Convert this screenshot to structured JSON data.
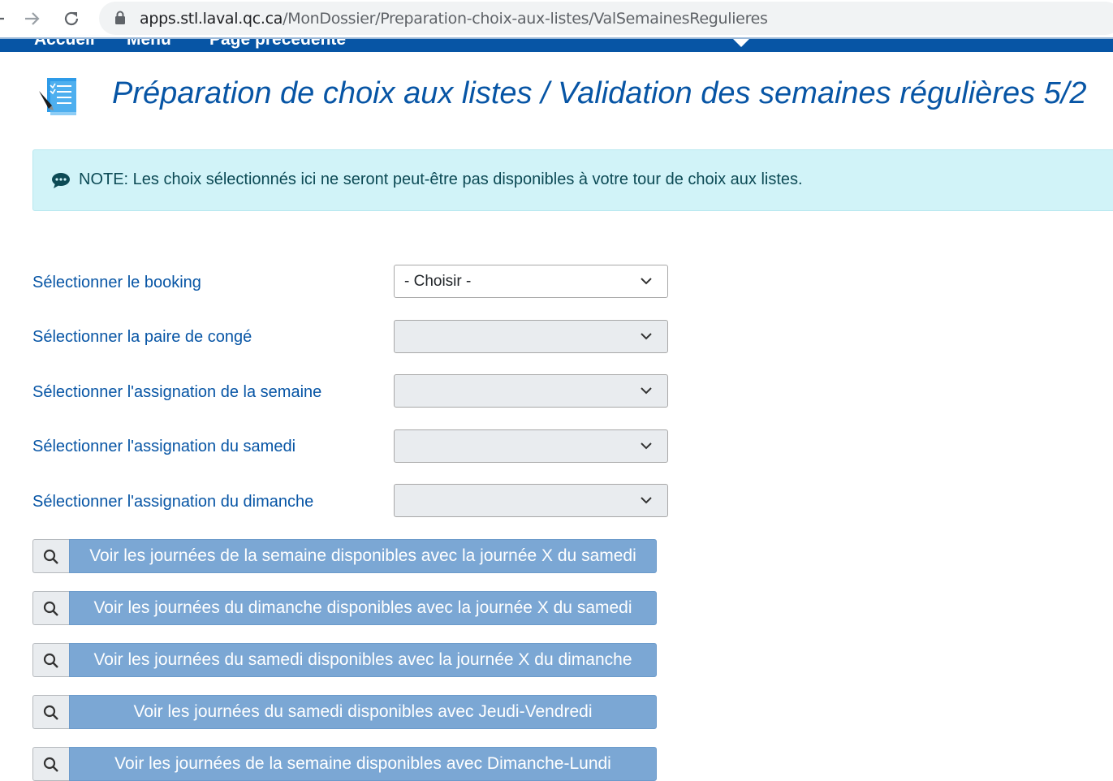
{
  "browser": {
    "url_host": "apps.stl.laval.qc.ca",
    "url_path": "/MonDossier/Preparation-choix-aux-listes/ValSemainesRegulieres"
  },
  "site_nav": {
    "links": [
      "Accueil",
      "Menu",
      "Page précédente"
    ]
  },
  "page": {
    "title": "Préparation de choix aux listes / Validation des semaines régulières 5/2"
  },
  "note": {
    "text": "NOTE: Les choix sélectionnés ici ne seront peut-être pas disponibles à votre tour de choix aux listes."
  },
  "form": {
    "fields": [
      {
        "label": "Sélectionner le booking",
        "value": "- Choisir -"
      },
      {
        "label": "Sélectionner la paire de congé",
        "value": ""
      },
      {
        "label": "Sélectionner l'assignation de la semaine",
        "value": ""
      },
      {
        "label": "Sélectionner l'assignation du samedi",
        "value": ""
      },
      {
        "label": "Sélectionner l'assignation du dimanche",
        "value": ""
      }
    ]
  },
  "actions": [
    {
      "label": "Voir les journées de la semaine disponibles avec la journée X du samedi"
    },
    {
      "label": "Voir les journées du dimanche disponibles avec la journée X du samedi"
    },
    {
      "label": "Voir les journées du samedi disponibles avec la journée X du dimanche"
    },
    {
      "label": "Voir les journées du samedi disponibles avec Jeudi-Vendredi"
    },
    {
      "label": "Voir les journées de la semaine disponibles avec Dimanche-Lundi"
    }
  ],
  "colors": {
    "primary": "#0755a5",
    "note_bg": "#d1f3f8",
    "action_bg": "#7ba7d4"
  },
  "icons": {
    "back": "back-arrow-icon",
    "forward": "forward-arrow-icon",
    "reload": "reload-icon",
    "lock": "lock-icon",
    "page": "checklist-document-icon",
    "note": "speech-bubble-icon",
    "dropdown": "chevron-down-icon",
    "action": "search-icon"
  }
}
